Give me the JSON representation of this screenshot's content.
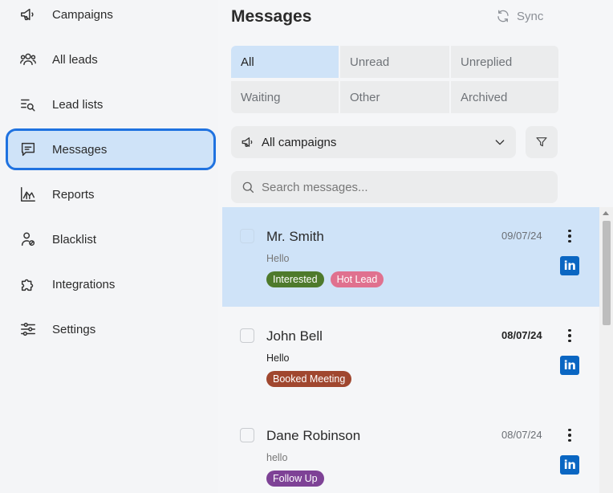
{
  "sidebar": {
    "items": [
      {
        "label": "Campaigns",
        "icon": "megaphone-icon"
      },
      {
        "label": "All leads",
        "icon": "users-icon"
      },
      {
        "label": "Lead lists",
        "icon": "list-search-icon"
      },
      {
        "label": "Messages",
        "icon": "message-icon",
        "active": true
      },
      {
        "label": "Reports",
        "icon": "chart-icon"
      },
      {
        "label": "Blacklist",
        "icon": "user-block-icon"
      },
      {
        "label": "Integrations",
        "icon": "puzzle-icon"
      },
      {
        "label": "Settings",
        "icon": "sliders-icon"
      }
    ]
  },
  "header": {
    "title": "Messages",
    "sync_label": "Sync"
  },
  "filters": [
    {
      "label": "All",
      "active": true
    },
    {
      "label": "Unread"
    },
    {
      "label": "Unreplied"
    },
    {
      "label": "Waiting"
    },
    {
      "label": "Other"
    },
    {
      "label": "Archived"
    }
  ],
  "campaign_select": {
    "value": "All campaigns"
  },
  "search": {
    "placeholder": "Search messages..."
  },
  "messages": [
    {
      "name": "Mr. Smith",
      "date": "09/07/24",
      "preview": "Hello",
      "unread": false,
      "selected": true,
      "tags": [
        {
          "label": "Interested",
          "color": "#4e7a2c"
        },
        {
          "label": "Hot Lead",
          "color": "#e0718f"
        }
      ]
    },
    {
      "name": "John Bell",
      "date": "08/07/24",
      "preview": "Hello",
      "unread": true,
      "selected": false,
      "tags": [
        {
          "label": "Booked Meeting",
          "color": "#a0472f"
        }
      ]
    },
    {
      "name": "Dane Robinson",
      "date": "08/07/24",
      "preview": "hello",
      "unread": false,
      "selected": false,
      "tags": [
        {
          "label": "Follow Up",
          "color": "#7e4296"
        }
      ]
    }
  ],
  "colors": {
    "accent": "#1f72e0",
    "active_bg": "#cfe3f8",
    "linkedin": "#0a66c2"
  }
}
